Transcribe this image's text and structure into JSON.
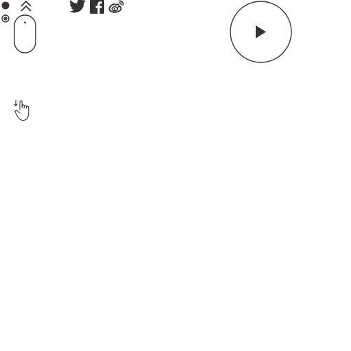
{
  "icons": {
    "pagination_dot_active": "filled-dot-icon",
    "pagination_dot_inactive": "ring-dot-icon",
    "scroll_up": "double-chevron-up-icon",
    "mouse": "mouse-scroll-icon",
    "hand": "hand-swipe-icon",
    "twitter": "twitter-icon",
    "facebook": "facebook-icon",
    "weibo": "weibo-icon",
    "play": "play-icon"
  },
  "colors": {
    "icon": "#333333",
    "background": "#ffffff"
  }
}
